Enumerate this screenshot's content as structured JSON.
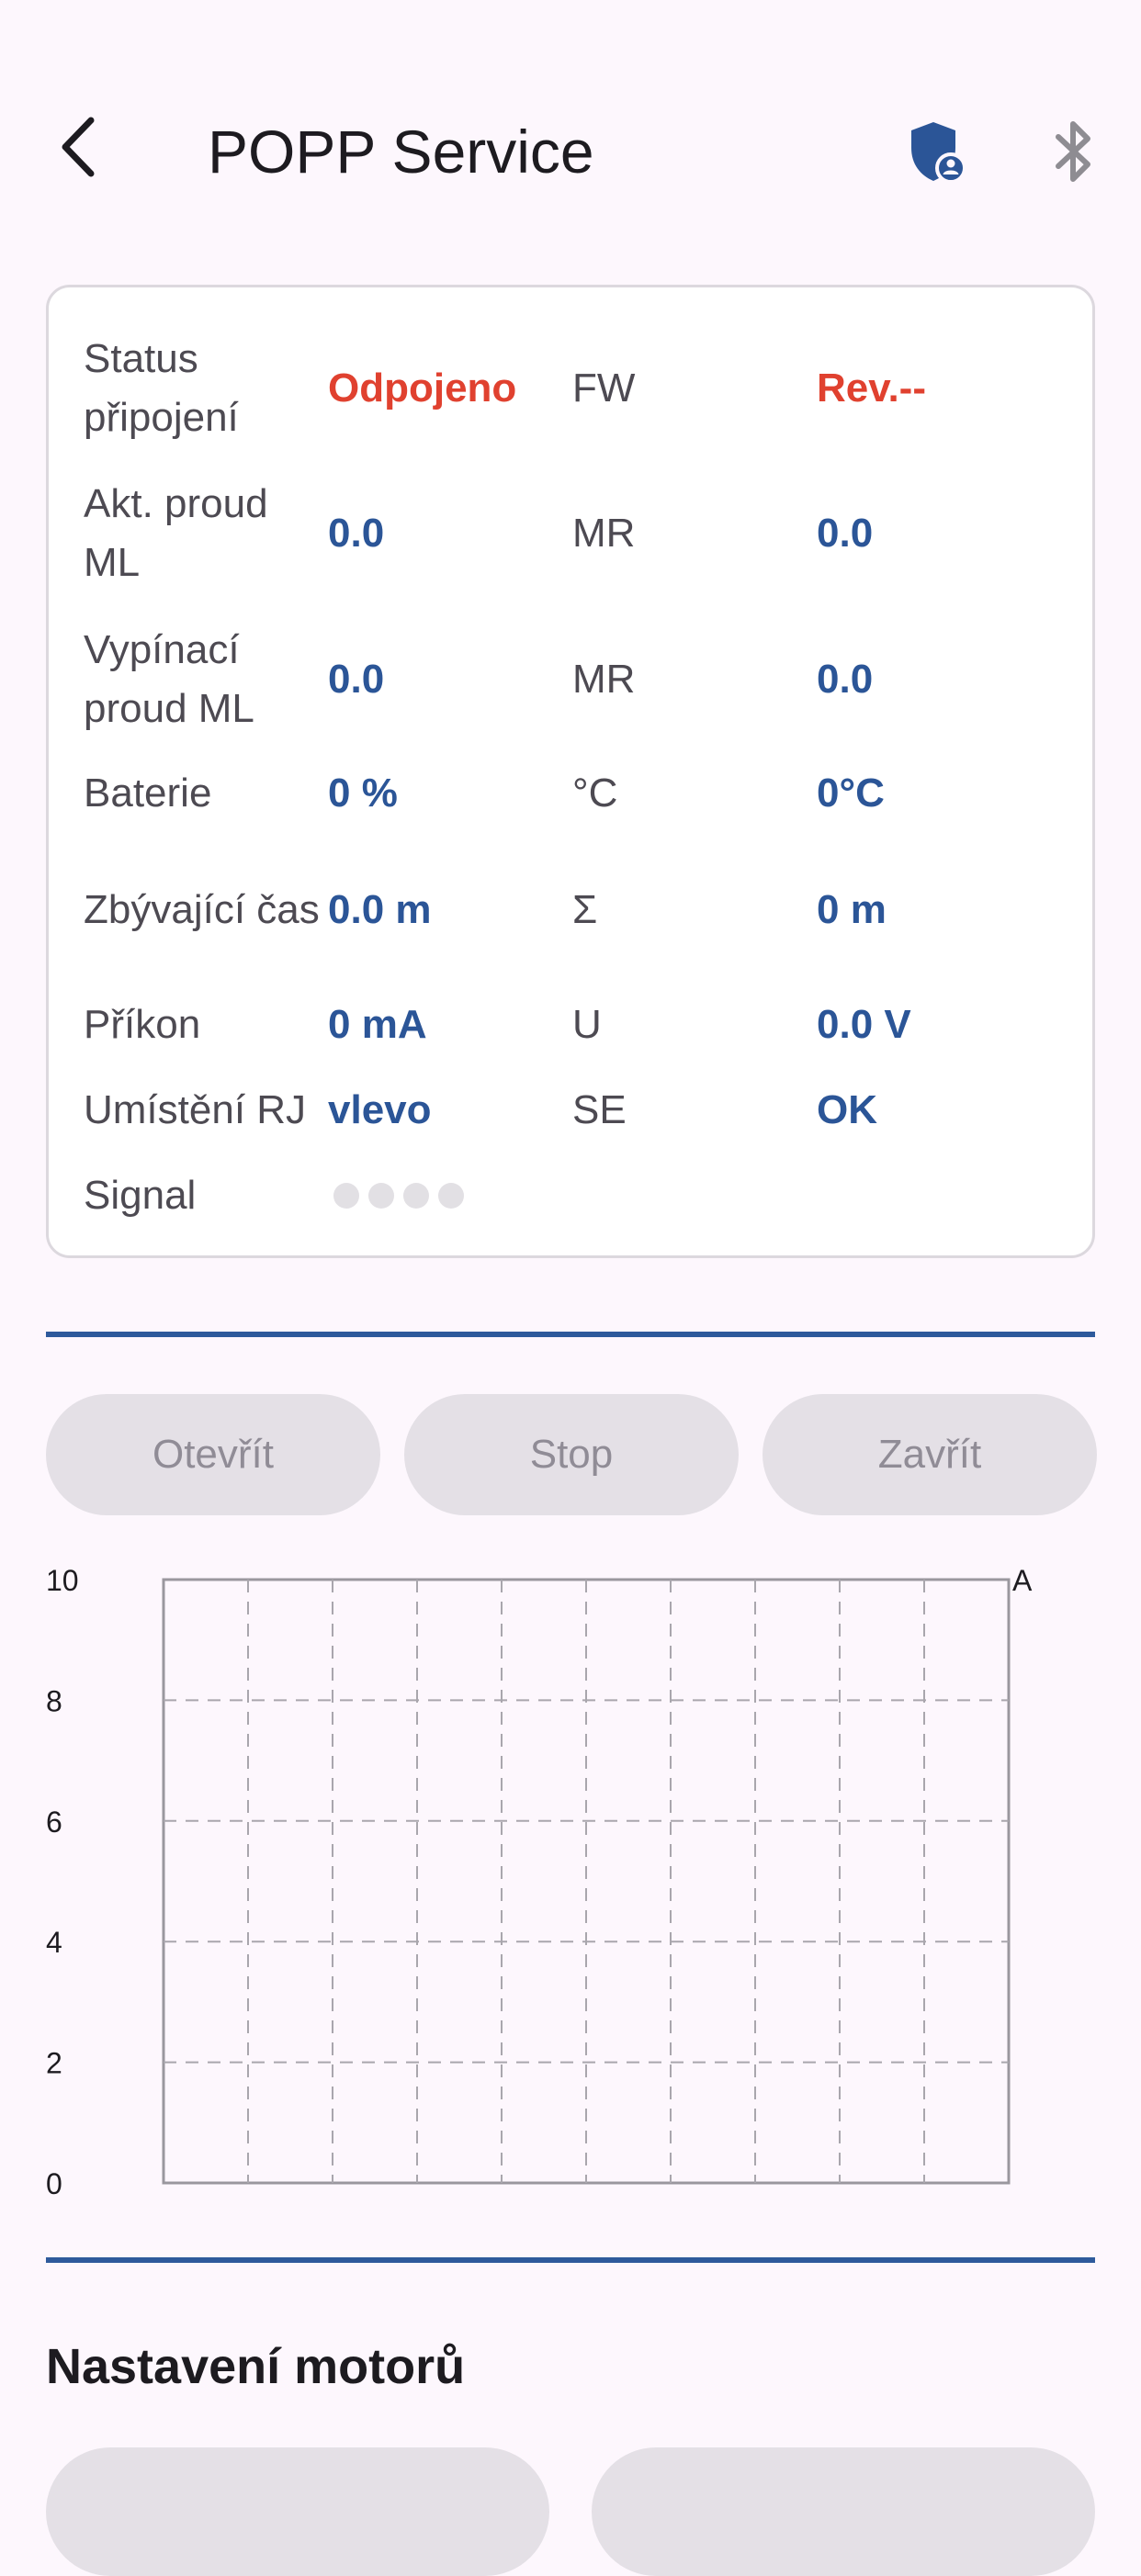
{
  "app_bar": {
    "title": "POPP Service",
    "back_icon": "arrow-back-icon",
    "shield_icon": "admin-shield-icon",
    "bluetooth_icon": "bluetooth-icon",
    "accent_color": "#2b5597"
  },
  "status": {
    "rows": [
      {
        "label": "Status připojení",
        "value": "Odpojeno",
        "label2": "FW",
        "value2": "Rev.--"
      },
      {
        "label": "Akt. proud ML",
        "value": "0.0",
        "label2": "MR",
        "value2": "0.0"
      },
      {
        "label": "Vypínací proud ML",
        "value": "0.0",
        "label2": "MR",
        "value2": "0.0"
      },
      {
        "label": "Baterie",
        "value": "0 %",
        "label2": "°C",
        "value2": "0°C"
      },
      {
        "label": "Zbývající čas",
        "value": "0.0 m",
        "label2": "Σ",
        "value2": "0 m"
      },
      {
        "label": "Příkon",
        "value": "0 mA",
        "label2": "U",
        "value2": "0.0 V"
      },
      {
        "label": "Umístění RJ",
        "value": "vlevo",
        "label2": "SE",
        "value2": "OK"
      },
      {
        "label": "Signal",
        "signal_bars": 4,
        "signal_active": 0
      }
    ],
    "error_color": "#e0412f"
  },
  "actions": {
    "open_label": "Otevřít",
    "stop_label": "Stop",
    "close_label": "Zavřít"
  },
  "chart_data": {
    "type": "line",
    "title": "",
    "xlabel": "",
    "ylabel": "A",
    "ylim": [
      0,
      10
    ],
    "yticks": [
      "0",
      "2",
      "4",
      "6",
      "8",
      "10"
    ],
    "x_divisions": 10,
    "grid": true,
    "series": []
  },
  "motor_settings": {
    "title": "Nastavení motorů"
  }
}
